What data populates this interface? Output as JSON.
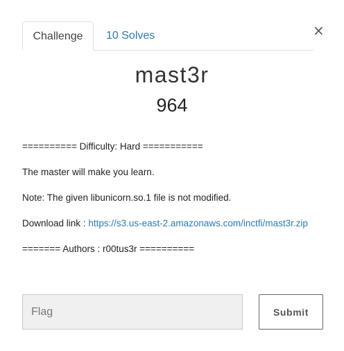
{
  "modal": {
    "close_symbol": "×",
    "close_icon": "close-icon"
  },
  "tabs": [
    {
      "label": "Challenge",
      "active": true
    },
    {
      "label": "10 Solves",
      "active": false
    }
  ],
  "challenge": {
    "name": "mast3r",
    "value": "964",
    "description": {
      "difficulty_line": "========== Difficulty: Hard ===========",
      "summary": "The master will make you learn.",
      "note": "Note: The given libunicorn.so.1 file is not modified.",
      "download_label": "Download link : ",
      "download_url": "https://s3.us-east-2.amazonaws.com/inctfi/mast3r.zip",
      "authors_line": "======= Authors : r00tus3r =========="
    }
  },
  "submission": {
    "placeholder": "Flag",
    "value": "",
    "submit_label": "Submit"
  },
  "colors": {
    "link": "#2a7ab6",
    "input_bg": "#f0f0f0"
  }
}
